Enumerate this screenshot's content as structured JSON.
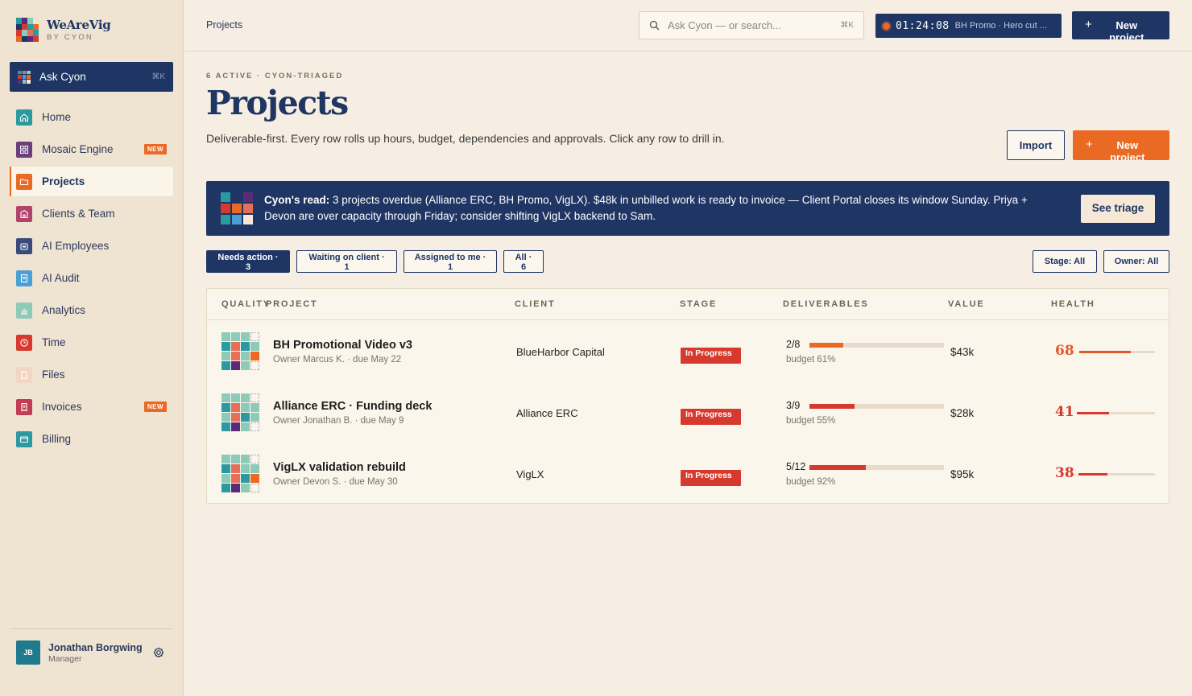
{
  "brand": {
    "name": "WeAreVig",
    "sub": "BY CYON"
  },
  "ask": {
    "label": "Ask Cyon",
    "kbd": "⌘K"
  },
  "nav": [
    {
      "label": "Home",
      "icon": "home-icon",
      "color": "#2b9aa0",
      "badge": ""
    },
    {
      "label": "Mosaic Engine",
      "icon": "grid-icon",
      "color": "#6a3f7e",
      "badge": "NEW"
    },
    {
      "label": "Projects",
      "icon": "folder-icon",
      "color": "#ea6a23",
      "badge": "",
      "active": true
    },
    {
      "label": "Clients & Team",
      "icon": "building-icon",
      "color": "#b0436a",
      "badge": ""
    },
    {
      "label": "AI Employees",
      "icon": "robot-icon",
      "color": "#3a4a7a",
      "badge": ""
    },
    {
      "label": "AI Audit",
      "icon": "document-icon",
      "color": "#4aa0d6",
      "badge": ""
    },
    {
      "label": "Analytics",
      "icon": "chart-icon",
      "color": "#8ecab8",
      "badge": ""
    },
    {
      "label": "Time",
      "icon": "clock-icon",
      "color": "#d63a2f",
      "badge": ""
    },
    {
      "label": "Files",
      "icon": "file-icon",
      "color": "#f3d6c1",
      "badge": ""
    },
    {
      "label": "Invoices",
      "icon": "receipt-icon",
      "color": "#c23d54",
      "badge": "NEW"
    },
    {
      "label": "Billing",
      "icon": "card-icon",
      "color": "#2b9aa0",
      "badge": ""
    }
  ],
  "user": {
    "initials": "JB",
    "name": "Jonathan Borgwing",
    "role": "Manager"
  },
  "topbar": {
    "breadcrumb": "Projects",
    "search_placeholder": "Ask Cyon — or search...",
    "search_kbd": "⌘K",
    "timer_time": "01:24:08",
    "timer_task": "BH Promo · Hero cut ...",
    "new_label": "New project"
  },
  "page": {
    "eyebrow": "6 ACTIVE · CYON-TRIAGED",
    "title": "Projects",
    "subtitle": "Deliverable-first. Every row rolls up hours, budget, dependencies and approvals. Click any row to drill in.",
    "import_label": "Import",
    "new_label": "New project"
  },
  "banner": {
    "lead": "Cyon's read:",
    "text": " 3 projects overdue (Alliance ERC, BH Promo, VigLX). $48k in unbilled work is ready to invoice — Client Portal closes its window Sunday. Priya + Devon are over capacity through Friday; consider shifting VigLX backend to Sam.",
    "button": "See triage"
  },
  "filters": [
    {
      "label": "Needs action ·",
      "count": "3",
      "active": true
    },
    {
      "label": "Waiting on client ·",
      "count": "1",
      "active": false
    },
    {
      "label": "Assigned to me ·",
      "count": "1",
      "active": false
    },
    {
      "label": "All ·",
      "count": "6",
      "active": false
    }
  ],
  "selects": {
    "stage": "Stage: All",
    "owner": "Owner: All"
  },
  "table": {
    "headers": {
      "quality": "QUALITY",
      "project": "PROJECT",
      "client": "CLIENT",
      "stage": "STAGE",
      "deliverables": "DELIVERABLES",
      "value": "VALUE",
      "health": "HEALTH"
    },
    "rows": [
      {
        "name": "BH Promotional Video v3",
        "meta": "Owner Marcus K. · due May 22",
        "client": "BlueHarbor Capital",
        "stage": "In Progress",
        "deliverables": "2/8",
        "deliv_progress": 0.25,
        "deliv_color": "#ea6a23",
        "budget": "budget 61%",
        "value": "$43k",
        "health": "68",
        "health_color": "#e0592a",
        "quality": [
          "#8ecab8",
          "#8ecab8",
          "#8ecab8",
          "",
          "#2b9aa0",
          "#e76f5a",
          "#2b9aa0",
          "#8ecab8",
          "#8ecab8",
          "#e76f5a",
          "#8ecab8",
          "#ea6a23",
          "#2b9aa0",
          "#5b2b7a",
          "#8ecab8",
          ""
        ]
      },
      {
        "name": "Alliance ERC · Funding deck",
        "meta": "Owner Jonathan B. · due May 9",
        "client": "Alliance ERC",
        "stage": "In Progress",
        "deliverables": "3/9",
        "deliv_progress": 0.333,
        "deliv_color": "#d63a2f",
        "budget": "budget 55%",
        "value": "$28k",
        "health": "41",
        "health_color": "#d63a2f",
        "quality": [
          "#8ecab8",
          "#8ecab8",
          "#8ecab8",
          "",
          "#2b9aa0",
          "#e76f5a",
          "#8ecab8",
          "#8ecab8",
          "#8ecab8",
          "#e76f5a",
          "#2b9aa0",
          "#8ecab8",
          "#2b9aa0",
          "#5b2b7a",
          "#8ecab8",
          ""
        ]
      },
      {
        "name": "VigLX validation rebuild",
        "meta": "Owner Devon S. · due May 30",
        "client": "VigLX",
        "stage": "In Progress",
        "deliverables": "5/12",
        "deliv_progress": 0.417,
        "deliv_color": "#d63a2f",
        "budget": "budget 92%",
        "value": "$95k",
        "health": "38",
        "health_color": "#d63a2f",
        "quality": [
          "#8ecab8",
          "#8ecab8",
          "#8ecab8",
          "",
          "#2b9aa0",
          "#e76f5a",
          "#8ecab8",
          "#8ecab8",
          "#8ecab8",
          "#e76f5a",
          "#2b9aa0",
          "#ea6a23",
          "#2b9aa0",
          "#5b2b7a",
          "#8ecab8",
          ""
        ]
      }
    ]
  },
  "colors": {
    "navy": "#1f3564",
    "orange": "#ea6a23",
    "red": "#d63a2f",
    "cream": "#f6eee2"
  }
}
